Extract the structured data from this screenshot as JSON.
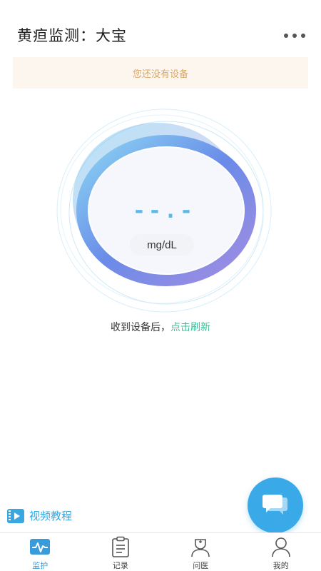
{
  "header": {
    "title": "黄疸监测：大宝",
    "more_icon": "more-dots-icon"
  },
  "notice": {
    "text": "您还没有设备"
  },
  "gauge": {
    "value": "--.-",
    "unit": "mg/dL",
    "colors": {
      "ring_start": "#8ad6f3",
      "ring_mid": "#6a8be8",
      "ring_end": "#a48de2",
      "value": "#5cb8e6"
    }
  },
  "refresh": {
    "prefix": "收到设备后，",
    "link": "点击刷新",
    "link_color": "#3fbf9a"
  },
  "video_tutorial": {
    "label": "视频教程",
    "icon": "film-icon"
  },
  "chat_fab": {
    "icon": "chat-bubbles-icon",
    "color": "#3aa9e8"
  },
  "tabs": [
    {
      "label": "监护",
      "icon": "pulse-icon",
      "active": true
    },
    {
      "label": "记录",
      "icon": "clipboard-icon",
      "active": false
    },
    {
      "label": "问医",
      "icon": "doctor-icon",
      "active": false
    },
    {
      "label": "我的",
      "icon": "user-icon",
      "active": false
    }
  ]
}
